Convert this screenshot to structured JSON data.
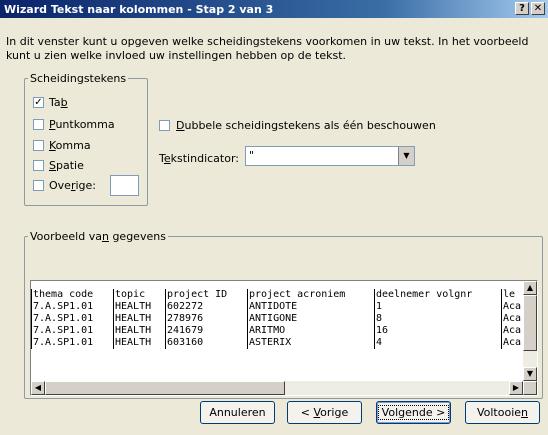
{
  "window": {
    "title": "Wizard Tekst naar kolommen - Stap 2 van 3",
    "help_glyph": "?",
    "close_glyph": "✕"
  },
  "intro_text": "In dit venster kunt u opgeven welke scheidingstekens voorkomen in uw tekst. In het voorbeeld kunt u zien welke invloed uw instellingen hebben op de tekst.",
  "separators": {
    "legend": "Scheidingstekens",
    "tab": {
      "pre": "Ta",
      "acc": "b",
      "post": "",
      "checked": true,
      "mark": "✓"
    },
    "semicolon": {
      "pre": "",
      "acc": "P",
      "post": "untkomma",
      "checked": false
    },
    "comma": {
      "pre": "",
      "acc": "K",
      "post": "omma",
      "checked": false
    },
    "space": {
      "pre": "",
      "acc": "S",
      "post": "patie",
      "checked": false
    },
    "other": {
      "pre": "Ove",
      "acc": "r",
      "post": "ige:",
      "checked": false,
      "value": ""
    }
  },
  "double_delims": {
    "pre": "",
    "acc": "D",
    "post": "ubbele scheidingstekens als één beschouwen",
    "checked": false
  },
  "text_qualifier": {
    "pre": "T",
    "acc": "e",
    "post": "kstindicator:",
    "value": "\""
  },
  "preview": {
    "legend_pre": "Voorbeeld va",
    "legend_acc": "n",
    "legend_post": " gegevens",
    "rows": [
      [
        "thema code",
        "topic",
        "project ID",
        "project acroniem",
        "deelnemer volgnr",
        "le"
      ],
      [
        "7.A.SP1.01",
        "HEALTH",
        "602272",
        "ANTIDOTE",
        "1",
        "Aca"
      ],
      [
        "7.A.SP1.01",
        "HEALTH",
        "278976",
        "ANTIGONE",
        "8",
        "Aca"
      ],
      [
        "7.A.SP1.01",
        "HEALTH",
        "241679",
        "ARITMO",
        "16",
        "Aca"
      ],
      [
        "7.A.SP1.01",
        "HEALTH",
        "603160",
        "ASTERIX",
        "4",
        "Aca"
      ]
    ]
  },
  "buttons": {
    "cancel": "Annuleren",
    "prev_pre": "< ",
    "prev_acc": "V",
    "prev_post": "orige",
    "next": "Volgende >",
    "finish_pre": "Voltooie",
    "finish_acc": "n",
    "finish_post": ""
  }
}
